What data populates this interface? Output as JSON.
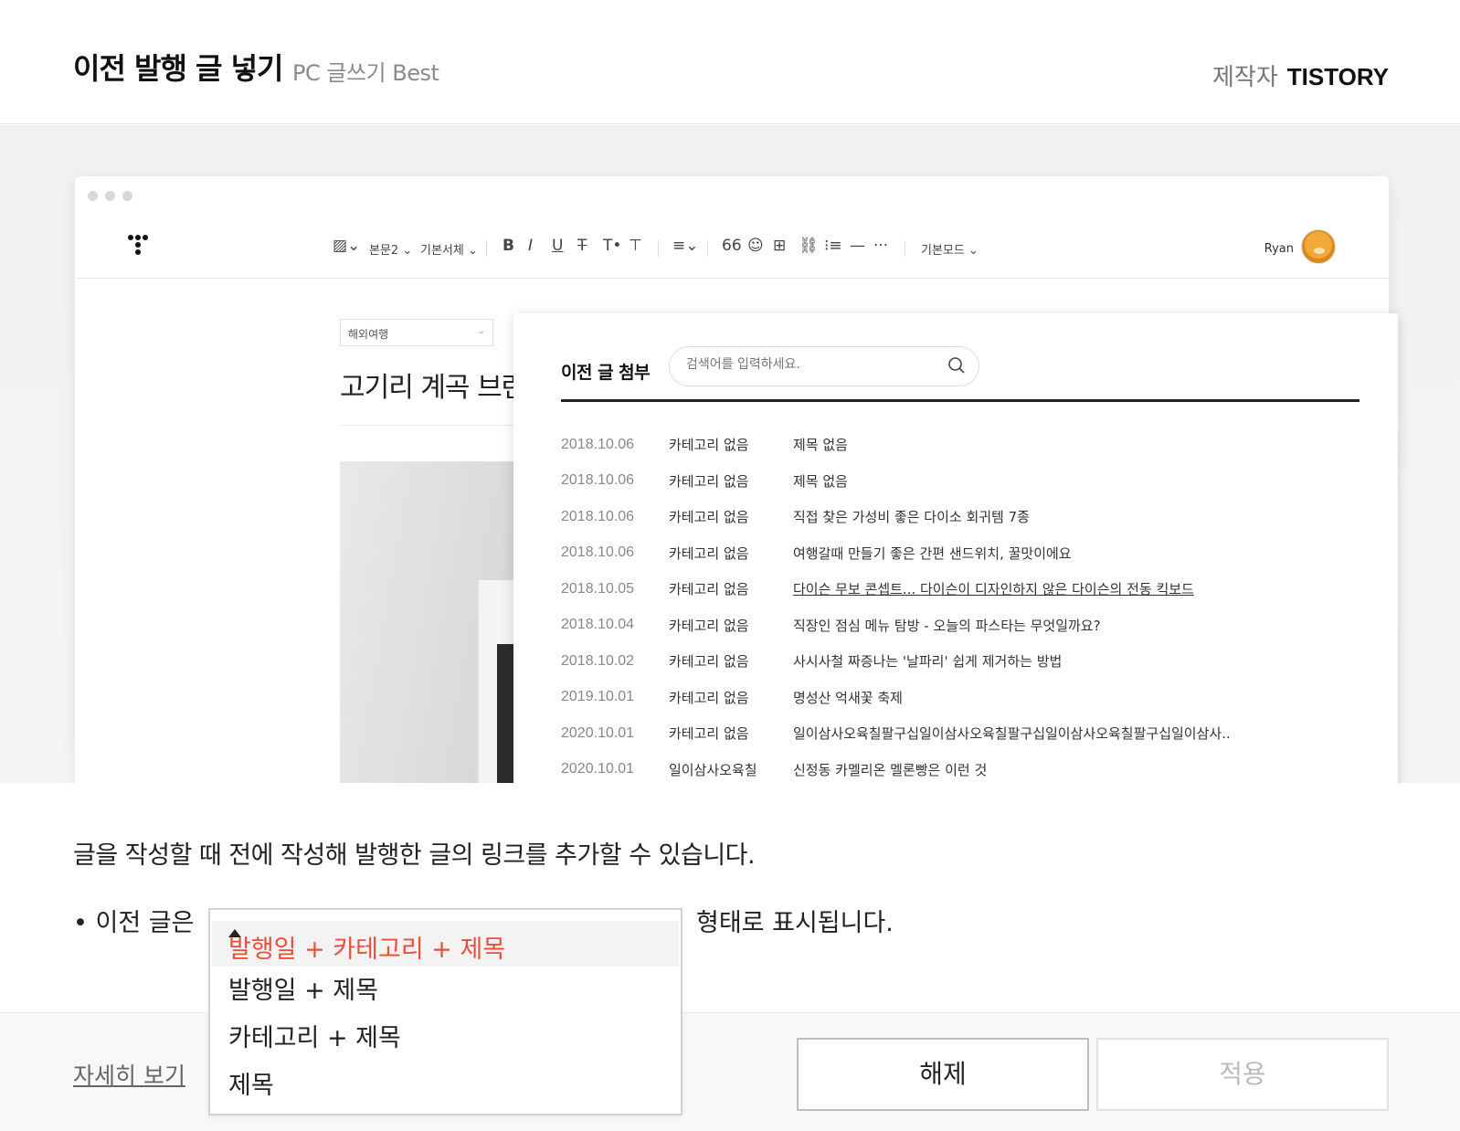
{
  "header": {
    "title": "이전 발행 글 넣기",
    "subtitle": "PC 글쓰기 Best",
    "maker_label": "제작자",
    "maker_name": "TISTORY"
  },
  "editor": {
    "toolbar": {
      "paragraph_style": "본문2 ⌄",
      "font": "기본서체 ⌄",
      "mode": "기본모드 ⌄",
      "user": "Ryan"
    },
    "category_select": "해외여행",
    "post_title": "고기리 계곡 브런"
  },
  "popup": {
    "title": "이전 글 첨부",
    "search_placeholder": "검색어를 입력하세요.",
    "rows": [
      {
        "date": "2018.10.06",
        "category": "카테고리 없음",
        "title": "제목 없음"
      },
      {
        "date": "2018.10.06",
        "category": "카테고리 없음",
        "title": "제목 없음"
      },
      {
        "date": "2018.10.06",
        "category": "카테고리 없음",
        "title": "직접 찾은 가성비 좋은 다이소 회귀템 7종"
      },
      {
        "date": "2018.10.06",
        "category": "카테고리 없음",
        "title": "여행갈때 만들기 좋은 간편 샌드위치, 꿀맛이에요"
      },
      {
        "date": "2018.10.05",
        "category": "카테고리 없음",
        "title": "다이슨 무보 콘셉트... 다이슨이 디자인하지 않은 다이슨의 전동 킥보드"
      },
      {
        "date": "2018.10.04",
        "category": "카테고리 없음",
        "title": "직장인 점심 메뉴 탐방 - 오늘의 파스타는 무엇일까요?"
      },
      {
        "date": "2018.10.02",
        "category": "카테고리 없음",
        "title": "사시사철 짜증나는 '날파리' 쉽게 제거하는 방법"
      },
      {
        "date": "2019.10.01",
        "category": "카테고리 없음",
        "title": "명성산 억새꽃 축제"
      },
      {
        "date": "2020.10.01",
        "category": "카테고리 없음",
        "title": "일이삼사오육칠팔구십일이삼사오육칠팔구십일이삼사오육칠팔구십일이삼사.."
      },
      {
        "date": "2020.10.01",
        "category": "일이삼사오육칠",
        "title": "신정동 카멜리온 멜론빵은 이런 것"
      }
    ]
  },
  "description": "글을 작성할 때 전에 작성해 발행한 글의 링크를 추가할 수 있습니다.",
  "format_setting": {
    "prefix": "• 이전 글은",
    "suffix": "형태로 표시됩니다.",
    "selected": "발행일 + 카테고리 + 제목",
    "options": [
      "발행일 + 제목",
      "카테고리 + 제목",
      "제목"
    ]
  },
  "footer": {
    "more_link": "자세히 보기",
    "release_button": "해제",
    "apply_button": "적용"
  },
  "colors": {
    "selected_option": "#e8503a",
    "disabled_text": "#bbbbbb"
  }
}
